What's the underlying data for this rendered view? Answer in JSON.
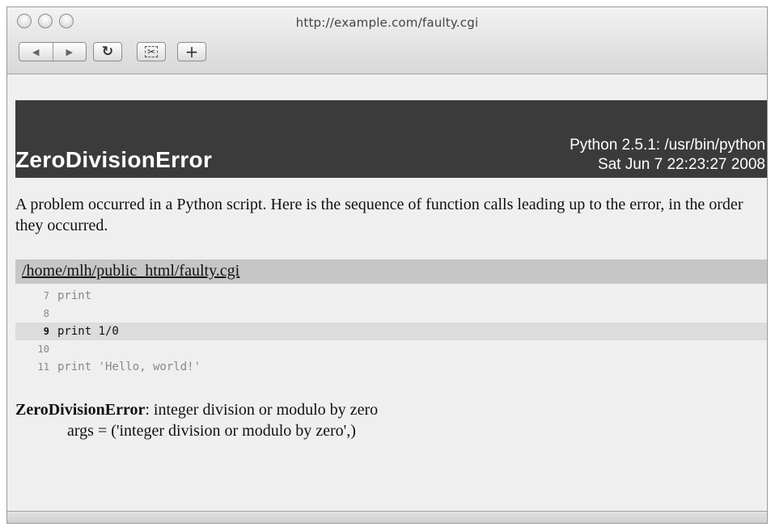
{
  "browser": {
    "url": "http://example.com/faulty.cgi",
    "buttons": {
      "back_icon": "◀",
      "forward_icon": "▶",
      "reload_icon": "↻",
      "snip_icon": "✂",
      "add_icon": "+"
    }
  },
  "error_page": {
    "title": "ZeroDivisionError",
    "python_info": "Python 2.5.1: /usr/bin/python",
    "date": "Sat Jun 7 22:23:27 2008",
    "intro": "A problem occurred in a Python script. Here is the sequence of function calls leading up to the error, in the order they occurred.",
    "file_path": "/home/mlh/public_html/faulty.cgi",
    "code_lines": [
      {
        "num": "7",
        "text": "print",
        "highlight": false
      },
      {
        "num": "8",
        "text": "",
        "highlight": false
      },
      {
        "num": "9",
        "text": "print 1/0",
        "highlight": true
      },
      {
        "num": "10",
        "text": "",
        "highlight": false
      },
      {
        "num": "11",
        "text": "print 'Hello, world!'",
        "highlight": false
      }
    ],
    "exception_name": "ZeroDivisionError",
    "exception_message": ": integer division or modulo by zero",
    "exception_args": "args = ('integer division or modulo by zero',)"
  },
  "colors": {
    "banner_bg": "#3b3b3b",
    "file_bar_bg": "#c6c6c6",
    "highlight_line_bg": "#dcdcdc",
    "page_bg": "#efefef"
  }
}
